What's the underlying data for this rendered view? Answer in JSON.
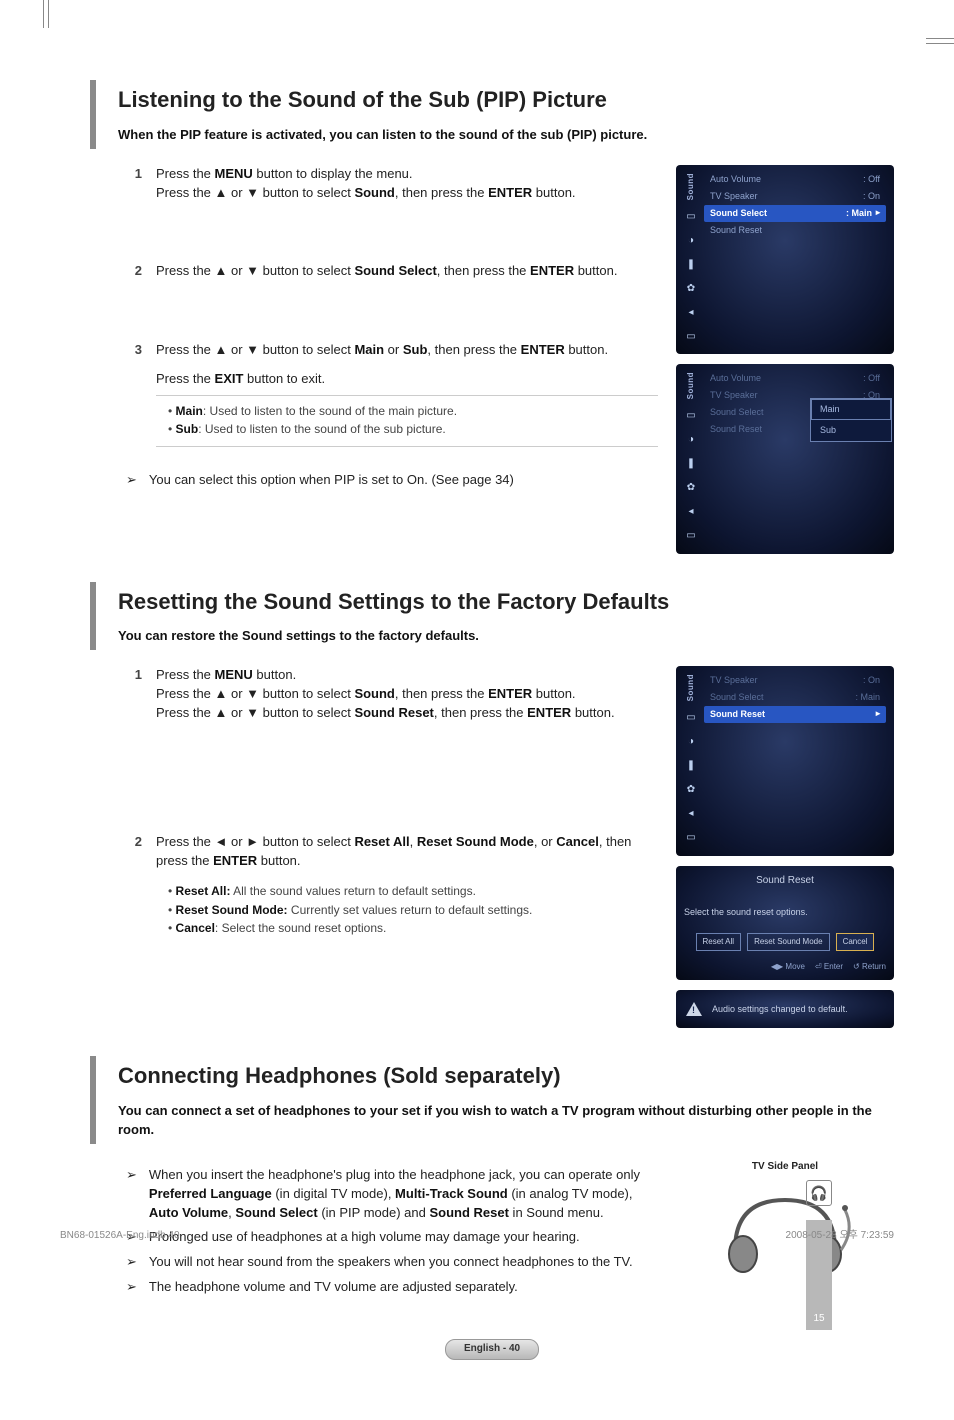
{
  "section1": {
    "title": "Listening to the Sound of the Sub (PIP) Picture",
    "intro": "When the PIP feature is activated, you can listen to the sound of the sub (PIP) picture.",
    "step1_num": "1",
    "step2_num": "2",
    "step3_num": "3",
    "s3_exit": "Press the EXIT button to exit.",
    "bullet_main_label": "Main",
    "bullet_main_text": ": Used to listen to the sound of the main picture.",
    "bullet_sub_label": "Sub",
    "bullet_sub_text": ": Used to listen to the sound of the sub picture.",
    "note": "You can select this option when PIP is set to On. (See page 34)"
  },
  "osd1": {
    "sidebar": "Sound",
    "r1_l": "Auto Volume",
    "r1_v": ": Off",
    "r2_l": "TV Speaker",
    "r2_v": ": On",
    "r3_l": "Sound Select",
    "r3_v": ": Main",
    "r4_l": "Sound Reset"
  },
  "osd2": {
    "sidebar": "Sound",
    "r1_l": "Auto Volume",
    "r1_v": ": Off",
    "r2_l": "TV Speaker",
    "r2_v": ": On",
    "r3_l": "Sound Select",
    "r4_l": "Sound Reset",
    "opt1": "Main",
    "opt2": "Sub"
  },
  "section2": {
    "title": "Resetting the Sound Settings to the Factory Defaults",
    "intro": "You can restore the Sound settings to the factory defaults.",
    "step1_num": "1",
    "step2_num": "2",
    "b1_label": "Reset All:",
    "b1_text": " All the sound values return to default settings.",
    "b2_label": "Reset Sound Mode:",
    "b2_text": " Currently set values return to default settings.",
    "b3_label": "Cancel",
    "b3_text": ": Select the sound reset options."
  },
  "osd3": {
    "sidebar": "Sound",
    "r1_l": "TV Speaker",
    "r1_v": ": On",
    "r2_l": "Sound Select",
    "r2_v": ": Main",
    "r3_l": "Sound Reset"
  },
  "sreset": {
    "title": "Sound Reset",
    "question": "Select the sound reset options.",
    "btn1": "Reset All",
    "btn2": "Reset Sound Mode",
    "btn3": "Cancel",
    "foot_move": "Move",
    "foot_enter": "Enter",
    "foot_return": "Return"
  },
  "alert": {
    "text": "Audio settings changed to default."
  },
  "section3": {
    "title": "Connecting Headphones (Sold separately)",
    "intro": "You can connect a set of headphones to your set if you wish to watch a TV program without disturbing other people in the room.",
    "n2": "Prolonged use of headphones at a high volume may damage your hearing.",
    "n3": "You will not hear sound from the speakers when you connect headphones to the TV.",
    "n4": "The headphone volume and TV volume are adjusted separately.",
    "panel_caption": "TV Side Panel",
    "strip_num": "15"
  },
  "footer": {
    "badge": "English - 40",
    "doc_left": "BN68-01526A-Eng.indb   40",
    "doc_right": "2008-05-28   오후 7:23:59"
  }
}
